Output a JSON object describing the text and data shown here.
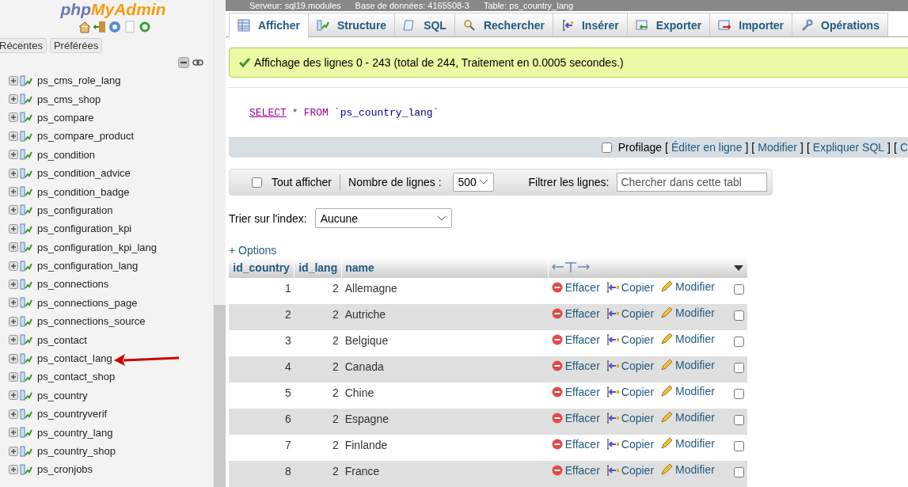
{
  "sidebar": {
    "logo": {
      "php": "php",
      "name": "MyAdmin"
    },
    "tabs": [
      {
        "label": "Récentes",
        "selected": false
      },
      {
        "label": "Préférées",
        "selected": false
      }
    ],
    "tables": [
      {
        "name": "ps_cms_role_lang",
        "arrow": false
      },
      {
        "name": "ps_cms_shop",
        "arrow": false
      },
      {
        "name": "ps_compare",
        "arrow": false
      },
      {
        "name": "ps_compare_product",
        "arrow": false
      },
      {
        "name": "ps_condition",
        "arrow": false
      },
      {
        "name": "ps_condition_advice",
        "arrow": false
      },
      {
        "name": "ps_condition_badge",
        "arrow": false
      },
      {
        "name": "ps_configuration",
        "arrow": false
      },
      {
        "name": "ps_configuration_kpi",
        "arrow": false
      },
      {
        "name": "ps_configuration_kpi_lang",
        "arrow": false
      },
      {
        "name": "ps_configuration_lang",
        "arrow": false
      },
      {
        "name": "ps_connections",
        "arrow": false
      },
      {
        "name": "ps_connections_page",
        "arrow": false
      },
      {
        "name": "ps_connections_source",
        "arrow": false
      },
      {
        "name": "ps_contact",
        "arrow": false
      },
      {
        "name": "ps_contact_lang",
        "arrow": true
      },
      {
        "name": "ps_contact_shop",
        "arrow": false
      },
      {
        "name": "ps_country",
        "arrow": false
      },
      {
        "name": "ps_countryverif",
        "arrow": false
      },
      {
        "name": "ps_country_lang",
        "arrow": false
      },
      {
        "name": "ps_country_shop",
        "arrow": false
      },
      {
        "name": "ps_cronjobs",
        "arrow": false
      }
    ]
  },
  "breadcrumb": [
    "Serveur: sql19.modules",
    "Base de données: 4165508-3",
    "Table: ps_country_lang"
  ],
  "tabs": [
    {
      "label": "Afficher",
      "selected": true
    },
    {
      "label": "Structure",
      "selected": false
    },
    {
      "label": "SQL",
      "selected": false
    },
    {
      "label": "Rechercher",
      "selected": false
    },
    {
      "label": "Insérer",
      "selected": false
    },
    {
      "label": "Exporter",
      "selected": false
    },
    {
      "label": "Importer",
      "selected": false
    },
    {
      "label": "Opérations",
      "selected": false
    }
  ],
  "message": "Affichage des lignes 0 - 243 (total de 244, Traitement en 0.0005 secondes.)",
  "query": {
    "keyword1": "SELECT",
    "star": "*",
    "keyword2": "FROM",
    "table": "`ps_country_lang`"
  },
  "query_links": {
    "profiling": {
      "label": "Profilage",
      "checked": false
    },
    "items": [
      {
        "kind": "bracket",
        "text": "["
      },
      {
        "kind": "link",
        "text": "Éditer en ligne"
      },
      {
        "kind": "bracket",
        "text": "]"
      },
      {
        "kind": "bracket",
        "text": "["
      },
      {
        "kind": "link",
        "text": "Modifier"
      },
      {
        "kind": "bracket",
        "text": "]"
      },
      {
        "kind": "bracket",
        "text": "["
      },
      {
        "kind": "link",
        "text": "Expliquer SQL"
      },
      {
        "kind": "bracket",
        "text": "]"
      },
      {
        "kind": "bracket",
        "text": "["
      },
      {
        "kind": "link",
        "text": "C"
      }
    ]
  },
  "nav": {
    "show_all": {
      "label": "Tout afficher",
      "checked": false
    },
    "rows_label": "Nombre de lignes :",
    "rows_value": "500",
    "filter_label": "Filtrer les lignes:",
    "filter_placeholder": "Chercher dans cette tabl"
  },
  "sort": {
    "label": "Trier sur l'index:",
    "value": "Aucune"
  },
  "options": "+ Options",
  "table": {
    "columns": [
      "id_country",
      "id_lang",
      "name"
    ],
    "rows": [
      {
        "cells": [
          "1",
          "2",
          "Allemagne"
        ],
        "actions": [
          "Effacer",
          "Copier",
          "Modifier"
        ],
        "checked": false
      },
      {
        "cells": [
          "2",
          "2",
          "Autriche"
        ],
        "actions": [
          "Effacer",
          "Copier",
          "Modifier"
        ],
        "checked": false
      },
      {
        "cells": [
          "3",
          "2",
          "Belgique"
        ],
        "actions": [
          "Effacer",
          "Copier",
          "Modifier"
        ],
        "checked": false
      },
      {
        "cells": [
          "4",
          "2",
          "Canada"
        ],
        "actions": [
          "Effacer",
          "Copier",
          "Modifier"
        ],
        "checked": false
      },
      {
        "cells": [
          "5",
          "2",
          "Chine"
        ],
        "actions": [
          "Effacer",
          "Copier",
          "Modifier"
        ],
        "checked": false
      },
      {
        "cells": [
          "6",
          "2",
          "Espagne"
        ],
        "actions": [
          "Effacer",
          "Copier",
          "Modifier"
        ],
        "checked": false
      },
      {
        "cells": [
          "7",
          "2",
          "Finlande"
        ],
        "actions": [
          "Effacer",
          "Copier",
          "Modifier"
        ],
        "checked": false
      },
      {
        "cells": [
          "8",
          "2",
          "France"
        ],
        "actions": [
          "Effacer",
          "Copier",
          "Modifier"
        ],
        "checked": false
      }
    ]
  }
}
